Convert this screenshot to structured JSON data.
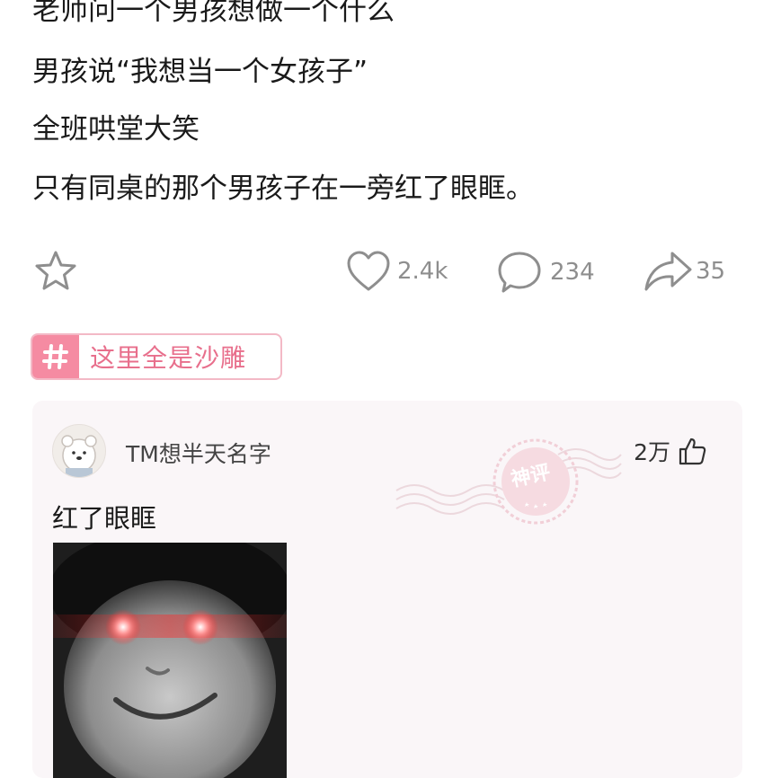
{
  "post": {
    "lines": [
      "老师问一个男孩想做一个什么",
      "男孩说“我想当一个女孩子”",
      "全班哄堂大笑",
      "只有同桌的那个男孩子在一旁红了眼眶。"
    ]
  },
  "actions": {
    "like_count": "2.4k",
    "comment_count": "234",
    "share_count": "35"
  },
  "tag": {
    "label": "这里全是沙雕"
  },
  "comment": {
    "username": "TM想半天名字",
    "likes": "2万",
    "text": "红了眼眶",
    "stamp_text": "神评"
  },
  "colors": {
    "accent_pink": "#f58ba2",
    "tag_text": "#e86f8c",
    "icon_gray": "#8e8e8e"
  }
}
